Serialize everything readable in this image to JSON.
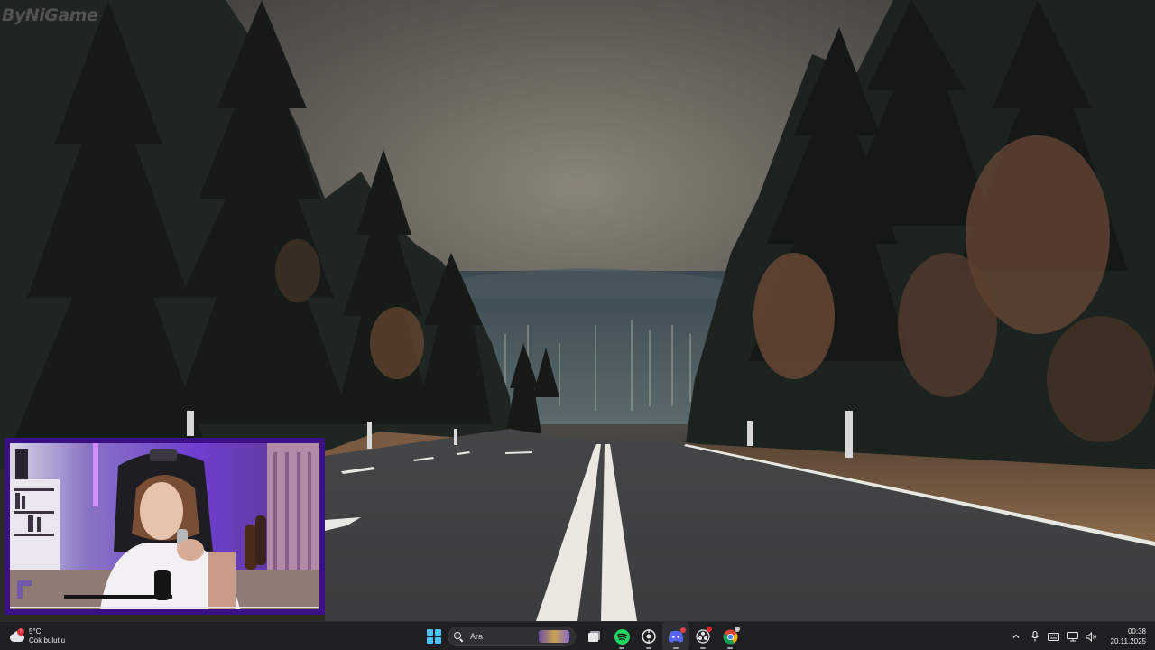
{
  "watermark": "ByNiGame",
  "taskbar": {
    "weather": {
      "temperature": "5°C",
      "description": "Çok bulutlu",
      "icon": "cloudy-weather-icon",
      "alert_badge": "!"
    },
    "search": {
      "placeholder": "Ara"
    },
    "pinned_apps": [
      {
        "name": "start-button",
        "icon": "windows-start-icon"
      },
      {
        "name": "task-view",
        "icon": "task-view-icon"
      },
      {
        "name": "spotify",
        "icon": "spotify-icon"
      },
      {
        "name": "steam",
        "icon": "steam-icon"
      },
      {
        "name": "discord",
        "icon": "discord-icon"
      },
      {
        "name": "obs-studio",
        "icon": "obs-icon"
      },
      {
        "name": "chrome",
        "icon": "chrome-icon"
      }
    ],
    "tray": {
      "overflow_chevron": "chevron-up-icon",
      "mic": "microphone-icon",
      "keyboard": "keyboard-icon",
      "network": "network-icon",
      "volume": "speaker-icon"
    },
    "clock": {
      "time": "00:38",
      "date": "20.11.2025"
    }
  },
  "colors": {
    "taskbar_bg": "#1e1f21",
    "webcam_frame": "#3b0f86",
    "start_blue": "#4cc2ff",
    "spotify_green": "#1ed760",
    "discord_blurple": "#5865f2"
  }
}
